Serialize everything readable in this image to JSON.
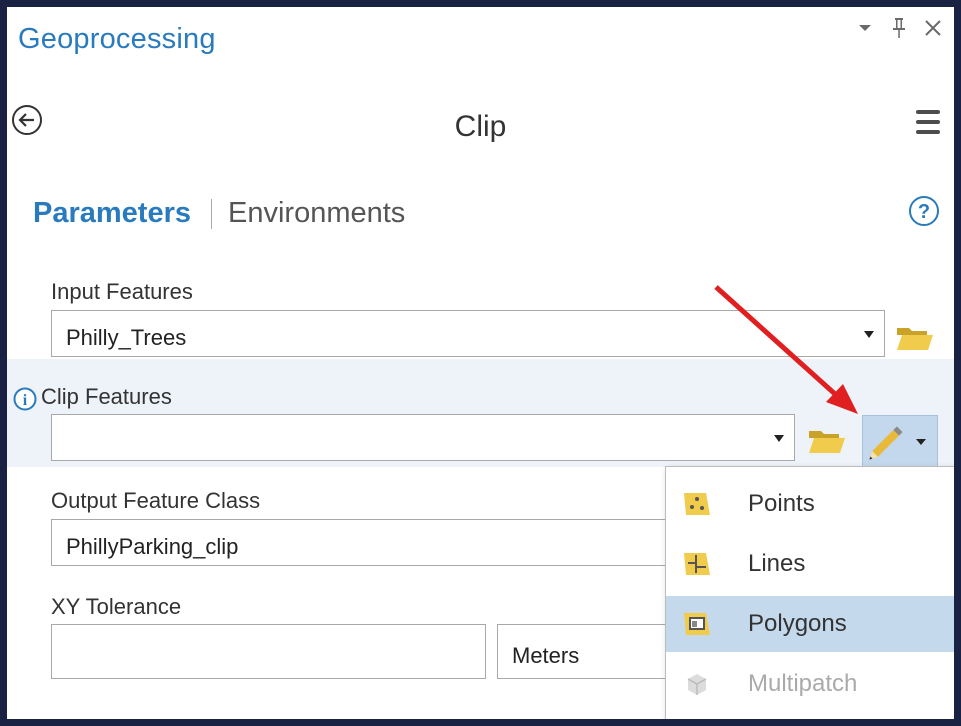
{
  "panel": {
    "title": "Geoprocessing",
    "controls": [
      "chevron-down-icon",
      "pin-icon",
      "close-icon"
    ]
  },
  "tool": {
    "title": "Clip",
    "back_icon": "back-arrow-circle-icon",
    "menu_icon": "hamburger-menu-icon"
  },
  "tabs": {
    "parameters": "Parameters",
    "environments": "Environments",
    "help_icon": "question-circle-icon"
  },
  "params": {
    "input_features": {
      "label": "Input Features",
      "value": "Philly_Trees"
    },
    "clip_features": {
      "label": "Clip Features",
      "value": ""
    },
    "output_feature_class": {
      "label": "Output Feature Class",
      "value": "PhillyParking_clip"
    },
    "xy_tolerance": {
      "label": "XY Tolerance",
      "value": "",
      "unit": "Meters"
    }
  },
  "sketch_menu": {
    "items": [
      {
        "label": "Points",
        "icon": "points-icon",
        "state": "normal"
      },
      {
        "label": "Lines",
        "icon": "lines-icon",
        "state": "normal"
      },
      {
        "label": "Polygons",
        "icon": "polygons-icon",
        "state": "selected"
      },
      {
        "label": "Multipatch",
        "icon": "multipatch-icon",
        "state": "disabled"
      }
    ]
  },
  "colors": {
    "accent": "#2a7bbd",
    "frame": "#1a2244",
    "annotation_arrow": "#e02020",
    "selected_item": "#c5d9ed"
  }
}
